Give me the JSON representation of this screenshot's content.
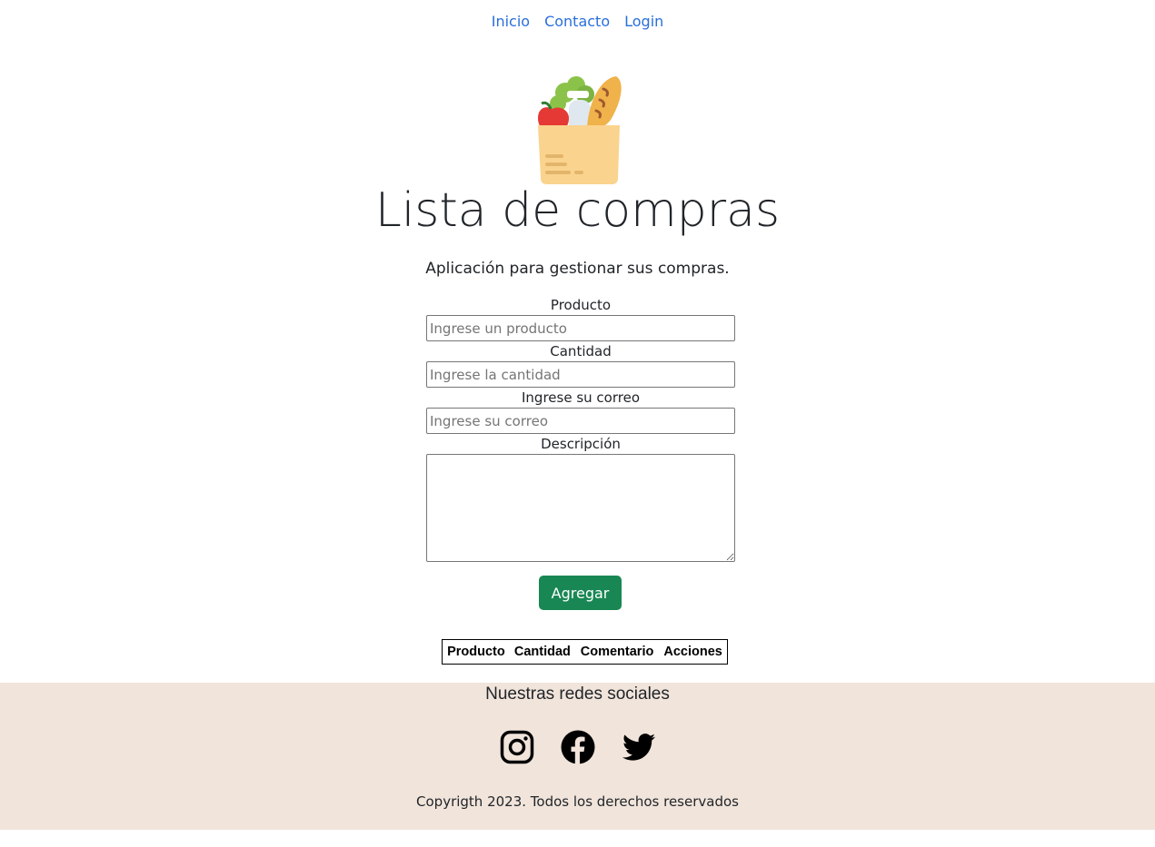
{
  "nav": {
    "items": [
      {
        "label": "Inicio"
      },
      {
        "label": "Contacto"
      },
      {
        "label": "Login"
      }
    ]
  },
  "header": {
    "logo_icon": "grocery-bag-icon",
    "title": "Lista de compras",
    "subtitle": "Aplicación para gestionar sus compras."
  },
  "form": {
    "producto": {
      "label": "Producto",
      "placeholder": "Ingrese un producto",
      "value": ""
    },
    "cantidad": {
      "label": "Cantidad",
      "placeholder": "Ingrese la cantidad",
      "value": ""
    },
    "correo": {
      "label": "Ingrese su correo",
      "placeholder": "Ingrese su correo",
      "value": ""
    },
    "descripcion": {
      "label": "Descripción",
      "value": ""
    },
    "submit_label": "Agregar"
  },
  "table": {
    "columns": [
      "Producto",
      "Cantidad",
      "Comentario",
      "Acciones"
    ]
  },
  "footer": {
    "title": "Nuestras redes sociales",
    "social_icons": [
      "instagram-icon",
      "facebook-icon",
      "twitter-icon"
    ],
    "copyright": "Copyrigth 2023. Todos los derechos reservados"
  },
  "colors": {
    "link": "#2a6fdb",
    "button": "#198754",
    "footer_bg": "#f1e4db"
  }
}
